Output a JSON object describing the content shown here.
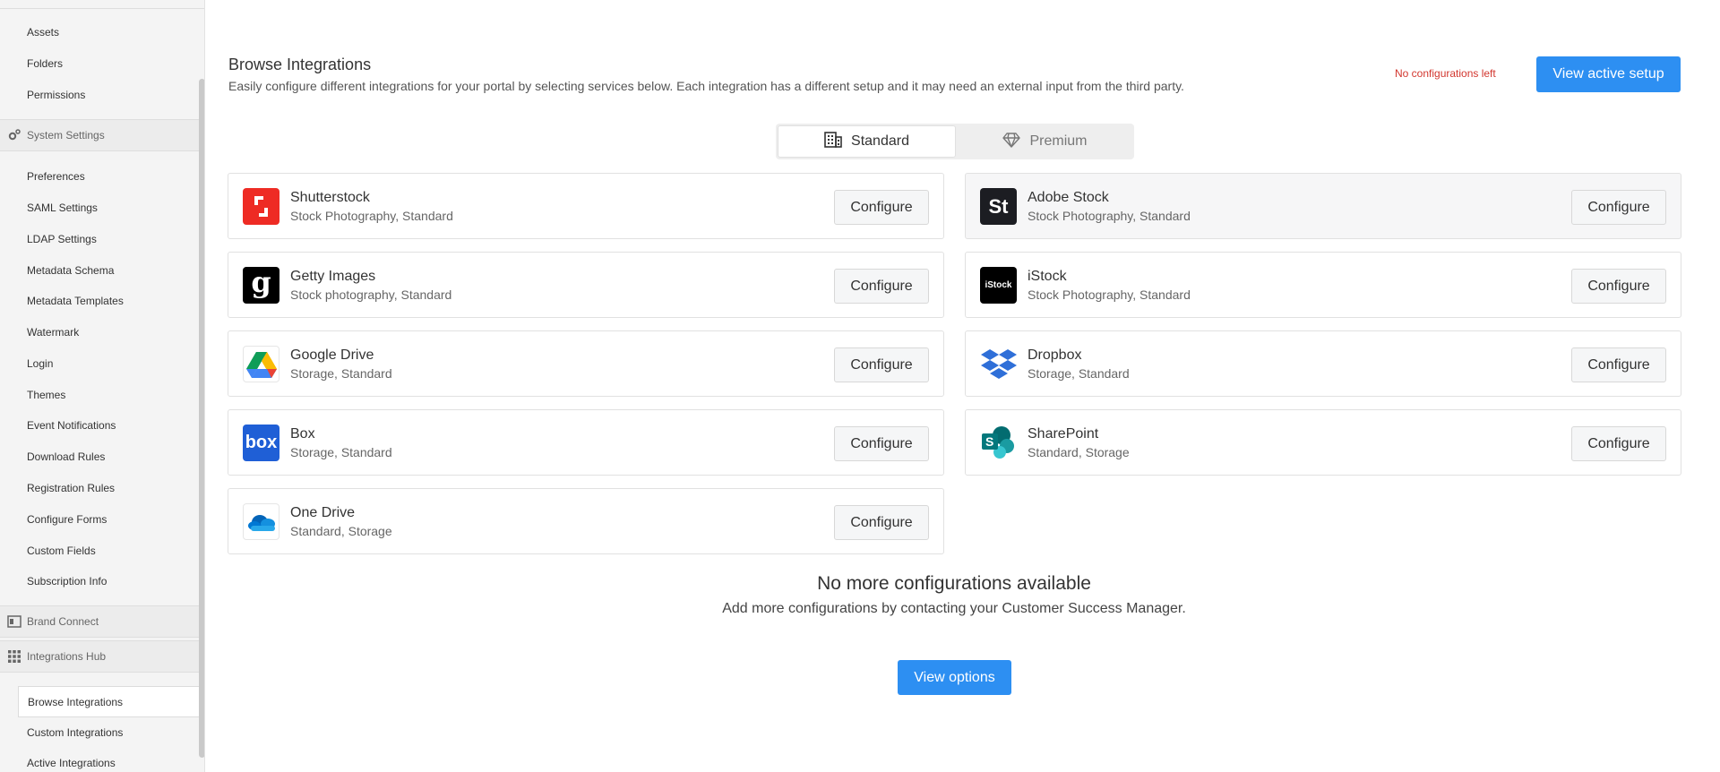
{
  "sidebar": {
    "items_top": [
      "Assets",
      "Folders",
      "Permissions"
    ],
    "system_settings": {
      "label": "System Settings",
      "items": [
        "Preferences",
        "SAML Settings",
        "LDAP Settings",
        "Metadata Schema",
        "Metadata Templates",
        "Watermark",
        "Login",
        "Themes",
        "Event Notifications",
        "Download Rules",
        "Registration Rules",
        "Configure Forms",
        "Custom Fields",
        "Subscription Info"
      ]
    },
    "brand_connect": {
      "label": "Brand Connect"
    },
    "integrations_hub": {
      "label": "Integrations Hub",
      "items": [
        "Browse Integrations",
        "Custom Integrations",
        "Active Integrations"
      ],
      "active": "Browse Integrations"
    }
  },
  "header": {
    "title": "Browse Integrations",
    "description": "Easily configure different integrations for your portal by selecting services below. Each integration has a different setup and it may need an external input from the third party.",
    "status": "No configurations left",
    "primary_button": "View active setup"
  },
  "tabs": [
    {
      "label": "Standard",
      "icon": "building-icon",
      "selected": true
    },
    {
      "label": "Premium",
      "icon": "diamond-icon",
      "selected": false
    }
  ],
  "integrations": [
    {
      "name": "Shutterstock",
      "tags": "Stock Photography, Standard",
      "button": "Configure",
      "logo": "shutterstock-logo"
    },
    {
      "name": "Adobe Stock",
      "tags": "Stock Photography, Standard",
      "button": "Configure",
      "logo": "adobe-stock-logo",
      "logo_text": "St"
    },
    {
      "name": "Getty Images",
      "tags": "Stock photography, Standard",
      "button": "Configure",
      "logo": "getty-images-logo",
      "logo_text": "g"
    },
    {
      "name": "iStock",
      "tags": "Stock Photography, Standard",
      "button": "Configure",
      "logo": "istock-logo",
      "logo_text": "iStock"
    },
    {
      "name": "Google Drive",
      "tags": "Storage, Standard",
      "button": "Configure",
      "logo": "google-drive-logo"
    },
    {
      "name": "Dropbox",
      "tags": "Storage, Standard",
      "button": "Configure",
      "logo": "dropbox-logo"
    },
    {
      "name": "Box",
      "tags": "Storage, Standard",
      "button": "Configure",
      "logo": "box-logo",
      "logo_text": "box"
    },
    {
      "name": "SharePoint",
      "tags": "Standard, Storage",
      "button": "Configure",
      "logo": "sharepoint-logo",
      "logo_text": "S"
    },
    {
      "name": "One Drive",
      "tags": "Standard, Storage",
      "button": "Configure",
      "logo": "onedrive-logo"
    }
  ],
  "empty_state": {
    "title": "No more configurations available",
    "description": "Add more configurations by contacting your Customer Success Manager.",
    "button": "View options"
  },
  "colors": {
    "primary": "#2d8ff2",
    "warning_text": "#d2362e",
    "active_indicator": "#0f6f7a"
  }
}
